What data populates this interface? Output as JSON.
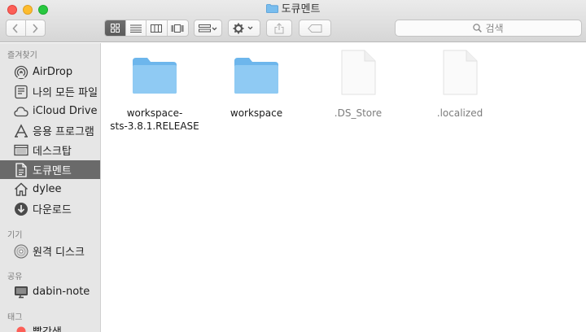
{
  "window": {
    "title": "도큐멘트"
  },
  "toolbar": {
    "back_icon": "chevron-left-icon",
    "forward_icon": "chevron-right-icon",
    "view_modes": [
      "icon-view-icon",
      "list-view-icon",
      "column-view-icon",
      "gallery-view-icon"
    ],
    "active_view": "icon-view-icon",
    "search_placeholder": "검색"
  },
  "sidebar": {
    "sections": [
      {
        "heading": "즐겨찾기",
        "items": [
          {
            "label": "AirDrop",
            "icon": "airdrop-icon"
          },
          {
            "label": "나의 모든 파일",
            "icon": "all-files-icon"
          },
          {
            "label": "iCloud Drive",
            "icon": "cloud-icon"
          },
          {
            "label": "응용 프로그램",
            "icon": "applications-icon"
          },
          {
            "label": "데스크탑",
            "icon": "desktop-icon"
          },
          {
            "label": "도큐멘트",
            "icon": "documents-icon",
            "selected": true
          },
          {
            "label": "dylee",
            "icon": "home-icon"
          },
          {
            "label": "다운로드",
            "icon": "downloads-icon"
          }
        ]
      },
      {
        "heading": "기기",
        "items": [
          {
            "label": "원격 디스크",
            "icon": "disc-icon"
          }
        ]
      },
      {
        "heading": "공유",
        "items": [
          {
            "label": "dabin-note",
            "icon": "computer-icon"
          }
        ]
      },
      {
        "heading": "태그",
        "items": [
          {
            "label": "빨간색",
            "icon": "red-tag-icon"
          }
        ]
      }
    ]
  },
  "files": [
    {
      "name_line1": "workspace-",
      "name_line2": "sts-3.8.1.RELEASE",
      "kind": "folder",
      "icon": "folder-icon"
    },
    {
      "name_line1": "workspace",
      "name_line2": "",
      "kind": "folder",
      "icon": "folder-icon"
    },
    {
      "name_line1": ".DS_Store",
      "name_line2": "",
      "kind": "document",
      "icon": "blank-document-icon"
    },
    {
      "name_line1": ".localized",
      "name_line2": "",
      "kind": "document",
      "icon": "blank-document-icon"
    }
  ],
  "colors": {
    "selection": "#6a6a6a",
    "folder": "#74bdf0",
    "sidebar_bg": "#e6e6e6",
    "red_tag": "#fc5f57"
  }
}
